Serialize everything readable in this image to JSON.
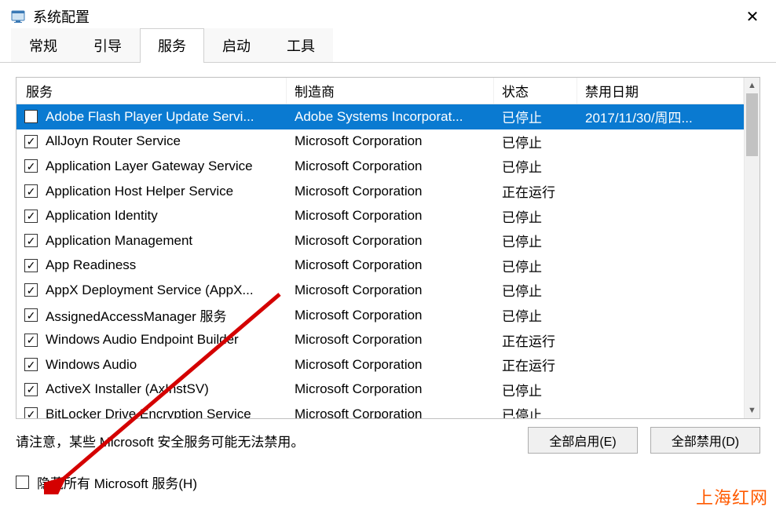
{
  "window": {
    "title": "系统配置",
    "close_symbol": "✕"
  },
  "tabs": [
    {
      "label": "常规"
    },
    {
      "label": "引导"
    },
    {
      "label": "服务"
    },
    {
      "label": "启动"
    },
    {
      "label": "工具"
    }
  ],
  "active_tab_index": 2,
  "columns": {
    "service": "服务",
    "manufacturer": "制造商",
    "status": "状态",
    "disabled_date": "禁用日期"
  },
  "rows": [
    {
      "checked": false,
      "selected": true,
      "service": "Adobe Flash Player Update Servi...",
      "manufacturer": "Adobe Systems Incorporat...",
      "status": "已停止",
      "date": "2017/11/30/周四..."
    },
    {
      "checked": true,
      "selected": false,
      "service": "AllJoyn Router Service",
      "manufacturer": "Microsoft Corporation",
      "status": "已停止",
      "date": ""
    },
    {
      "checked": true,
      "selected": false,
      "service": "Application Layer Gateway Service",
      "manufacturer": "Microsoft Corporation",
      "status": "已停止",
      "date": ""
    },
    {
      "checked": true,
      "selected": false,
      "service": "Application Host Helper Service",
      "manufacturer": "Microsoft Corporation",
      "status": "正在运行",
      "date": ""
    },
    {
      "checked": true,
      "selected": false,
      "service": "Application Identity",
      "manufacturer": "Microsoft Corporation",
      "status": "已停止",
      "date": ""
    },
    {
      "checked": true,
      "selected": false,
      "service": "Application Management",
      "manufacturer": "Microsoft Corporation",
      "status": "已停止",
      "date": ""
    },
    {
      "checked": true,
      "selected": false,
      "service": "App Readiness",
      "manufacturer": "Microsoft Corporation",
      "status": "已停止",
      "date": ""
    },
    {
      "checked": true,
      "selected": false,
      "service": "AppX Deployment Service (AppX...",
      "manufacturer": "Microsoft Corporation",
      "status": "已停止",
      "date": ""
    },
    {
      "checked": true,
      "selected": false,
      "service": "AssignedAccessManager 服务",
      "manufacturer": "Microsoft Corporation",
      "status": "已停止",
      "date": ""
    },
    {
      "checked": true,
      "selected": false,
      "service": "Windows Audio Endpoint Builder",
      "manufacturer": "Microsoft Corporation",
      "status": "正在运行",
      "date": ""
    },
    {
      "checked": true,
      "selected": false,
      "service": "Windows Audio",
      "manufacturer": "Microsoft Corporation",
      "status": "正在运行",
      "date": ""
    },
    {
      "checked": true,
      "selected": false,
      "service": "ActiveX Installer (AxInstSV)",
      "manufacturer": "Microsoft Corporation",
      "status": "已停止",
      "date": ""
    },
    {
      "checked": true,
      "selected": false,
      "service": "BitLocker Drive Encryption Service",
      "manufacturer": "Microsoft Corporation",
      "status": "已停止",
      "date": ""
    }
  ],
  "note": "请注意，某些 Microsoft 安全服务可能无法禁用。",
  "buttons": {
    "enable_all": "全部启用(E)",
    "disable_all": "全部禁用(D)"
  },
  "hide_ms": {
    "checked": false,
    "label": "隐藏所有 Microsoft 服务(H)"
  },
  "watermark": "上海红网"
}
